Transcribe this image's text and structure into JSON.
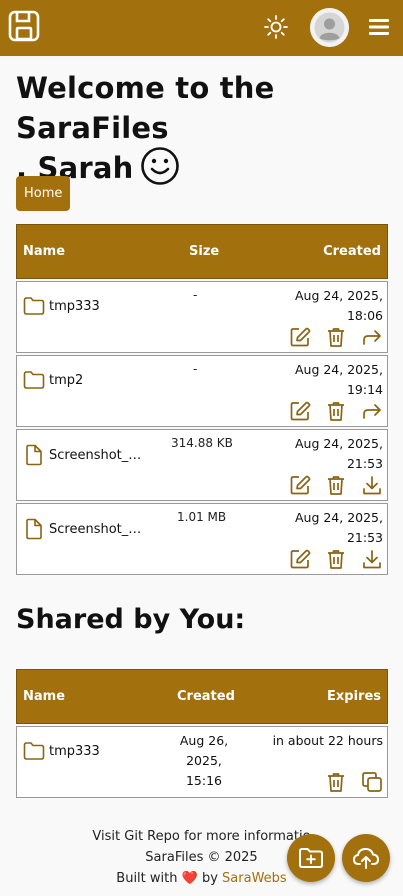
{
  "header": {
    "logo_icon": "save-floppy-icon",
    "theme_icon": "sun-icon",
    "avatar_icon": "user-avatar-icon",
    "menu_icon": "hamburger-icon"
  },
  "welcome": {
    "line1": "Welcome to the SaraFiles",
    "line2": ", Sarah",
    "emoji_icon": "smiley-icon"
  },
  "breadcrumb": {
    "home": "Home"
  },
  "files_table": {
    "columns": {
      "name": "Name",
      "size": "Size",
      "created": "Created"
    },
    "rows": [
      {
        "name": "tmp333",
        "type": "folder",
        "size": "-",
        "created_line1": "Aug 24, 2025,",
        "created_line2": "18:06",
        "third_action_icon": "share-arrow-icon"
      },
      {
        "name": "tmp2",
        "type": "folder",
        "size": "-",
        "created_line1": "Aug 24, 2025,",
        "created_line2": "19:14",
        "third_action_icon": "share-arrow-icon"
      },
      {
        "name": "Screenshot_…",
        "type": "file",
        "size": "314.88 KB",
        "created_line1": "Aug 24, 2025,",
        "created_line2": "21:53",
        "third_action_icon": "download-icon"
      },
      {
        "name": "Screenshot_…",
        "type": "file",
        "size": "1.01 MB",
        "created_line1": "Aug 24, 2025,",
        "created_line2": "21:53",
        "third_action_icon": "download-icon"
      }
    ]
  },
  "shared": {
    "title": "Shared by You:",
    "columns": {
      "name": "Name",
      "created": "Created",
      "expires": "Expires"
    },
    "rows": [
      {
        "name": "tmp333",
        "created_line1": "Aug 26, 2025,",
        "created_line2": "15:16",
        "expires": "in about 22 hours"
      }
    ]
  },
  "footer": {
    "line1": "Visit Git Repo for more informatio",
    "line2": "SaraFiles © 2025",
    "line3_prefix": "Built with",
    "heart": "❤️",
    "line3_by": "by",
    "brand": "SaraWebs"
  },
  "fabs": {
    "new_folder_icon": "folder-add-icon",
    "upload_icon": "cloud-upload-icon"
  },
  "colors": {
    "accent": "#a2700d",
    "background": "#f9f9f9",
    "row_bg": "#ffffff"
  }
}
